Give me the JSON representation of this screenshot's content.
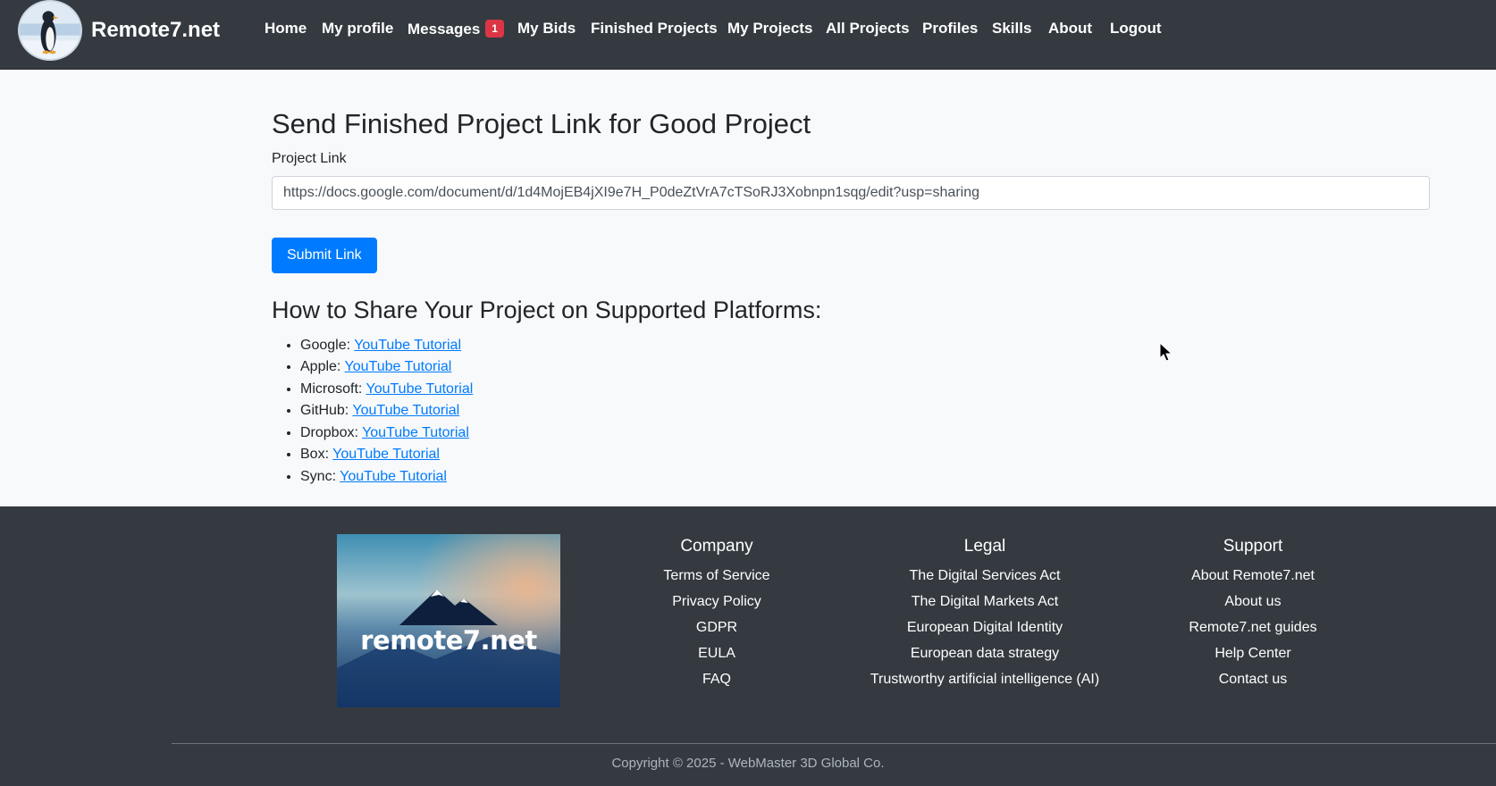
{
  "brand": {
    "name": "Remote7.net"
  },
  "nav": {
    "items": [
      {
        "label": "Home"
      },
      {
        "label": "My profile"
      },
      {
        "label": "Messages",
        "badge": "1"
      },
      {
        "label": "My Bids"
      },
      {
        "label": "Finished Projects"
      },
      {
        "label": "My Projects"
      },
      {
        "label": "All Projects"
      },
      {
        "label": "Profiles"
      },
      {
        "label": "Skills"
      },
      {
        "label": "About"
      },
      {
        "label": "Logout"
      }
    ]
  },
  "form": {
    "title": "Send Finished Project Link for Good Project",
    "label": "Project Link",
    "value": "https://docs.google.com/document/d/1d4MojEB4jXI9e7H_P0deZtVrA7cTSoRJ3Xobnpn1sqg/edit?usp=sharing",
    "submit_label": "Submit Link"
  },
  "share": {
    "title": "How to Share Your Project on Supported Platforms:",
    "items": [
      {
        "platform": "Google:",
        "link": "YouTube Tutorial"
      },
      {
        "platform": "Apple:",
        "link": "YouTube Tutorial"
      },
      {
        "platform": "Microsoft:",
        "link": "YouTube Tutorial"
      },
      {
        "platform": "GitHub:",
        "link": "YouTube Tutorial"
      },
      {
        "platform": "Dropbox:",
        "link": "YouTube Tutorial"
      },
      {
        "platform": "Box:",
        "link": "YouTube Tutorial"
      },
      {
        "platform": "Sync:",
        "link": "YouTube Tutorial"
      }
    ]
  },
  "footer": {
    "logo_text": "remote7.net",
    "columns": [
      {
        "title": "Company",
        "links": [
          "Terms of Service",
          "Privacy Policy",
          "GDPR",
          "EULA",
          "FAQ"
        ]
      },
      {
        "title": "Legal",
        "links": [
          "The Digital Services Act",
          "The Digital Markets Act",
          "European Digital Identity",
          "European data strategy",
          "Trustworthy artificial intelligence (AI)"
        ]
      },
      {
        "title": "Support",
        "links": [
          "About Remote7.net",
          "About us",
          "Remote7.net guides",
          "Help Center",
          "Contact us"
        ]
      }
    ],
    "copyright": "Copyright © 2025 - WebMaster 3D Global Co."
  },
  "colors": {
    "navbar": "#343a40",
    "primary": "#007bff",
    "badge": "#dc3545",
    "page_bg": "#f8f9fa"
  }
}
